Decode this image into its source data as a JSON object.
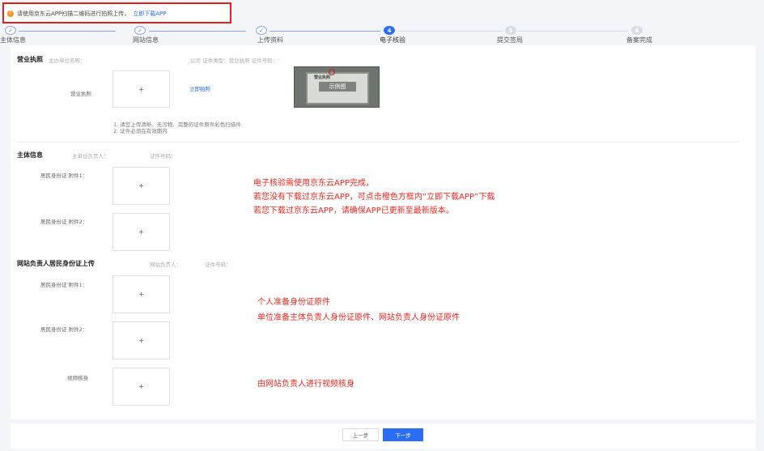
{
  "notice": {
    "text": "请使用京东云APP扫描二维码进行拍照上传，",
    "link": "立即下载APP"
  },
  "steps": [
    {
      "number": "",
      "label": "主体信息",
      "state": "done"
    },
    {
      "number": "",
      "label": "网站信息",
      "state": "done"
    },
    {
      "number": "",
      "label": "上传资料",
      "state": "done"
    },
    {
      "number": "4",
      "label": "电子核验",
      "state": "active"
    },
    {
      "number": "5",
      "label": "提交签局",
      "state": "todo"
    },
    {
      "number": "6",
      "label": "备案完成",
      "state": "todo"
    }
  ],
  "license": {
    "title": "营业执照",
    "meta_name": "主办单位名称：",
    "meta_rest": "公司  证件类型：营业执照  证件号码：'",
    "field_label": "营业执照",
    "upload_plus": "+",
    "shoot_link": "立即拍照",
    "sample_tag": "示例图",
    "sample_doc_title": "营业执照",
    "notes": [
      "1. 请您上传清晰、无污物、完整的证件原件彩色扫描件",
      "2. 证件必须在有效期内"
    ]
  },
  "subject": {
    "title": "主体信息",
    "meta_person": "主单位负责人：",
    "meta_id": "证件号码：",
    "id1_label": "居民身份证 附件1：",
    "id2_label": "居民身份证 附件2：",
    "upload_plus": "+"
  },
  "site_owner": {
    "title": "网站负责人居民身份证上传",
    "meta_person": "网站负责人：",
    "meta_id": "证件号码：",
    "id1_label": "居民身份证 附件1：",
    "id2_label": "居民身份证 附件2：",
    "video_label": "视频核身",
    "upload_plus": "+"
  },
  "annotations": {
    "block1": [
      "电子核验需使用京东云APP完成，",
      "若您没有下载过京东云APP，可点击橙色方框内“立即下载APP”下载",
      "若您下载过京东云APP，请确保APP已更新至最新版本。"
    ],
    "block2": [
      "个人准备身份证原件",
      "单位准备主体负责人身份证原件、网站负责人身份证原件"
    ],
    "block3": "由网站负责人进行视频核身"
  },
  "footer": {
    "prev": "上一步",
    "next": "下一步"
  },
  "colors": {
    "accent": "#2a6ef6",
    "annotation_red": "#e52920",
    "notice_border": "#e0201e",
    "warning_orange": "#f59a23"
  }
}
